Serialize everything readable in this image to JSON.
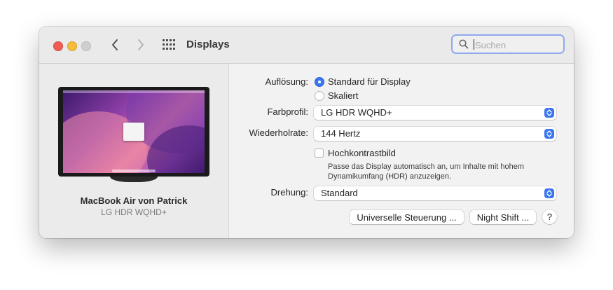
{
  "window": {
    "title": "Displays"
  },
  "search": {
    "placeholder": "Suchen",
    "value": ""
  },
  "display": {
    "name": "MacBook Air von Patrick",
    "model": "LG HDR WQHD+"
  },
  "settings": {
    "resolution": {
      "label": "Auflösung:",
      "options": [
        {
          "label": "Standard für Display",
          "selected": true
        },
        {
          "label": "Skaliert",
          "selected": false
        }
      ]
    },
    "color_profile": {
      "label": "Farbprofil:",
      "value": "LG HDR WQHD+"
    },
    "refresh_rate": {
      "label": "Wiederholrate:",
      "value": "144 Hertz"
    },
    "high_contrast": {
      "label": "Hochkontrastbild",
      "checked": false,
      "description_line1": "Passe das Display automatisch an, um Inhalte mit hohem",
      "description_line2": "Dynamikumfang (HDR) anzuzeigen."
    },
    "rotation": {
      "label": "Drehung:",
      "value": "Standard"
    }
  },
  "buttons": {
    "universal_control": "Universelle Steuerung ...",
    "night_shift": "Night Shift ...",
    "help": "?"
  },
  "colors": {
    "accent": "#3a76f0",
    "traffic_red": "#ee5e57",
    "traffic_yellow": "#f5bd3a"
  }
}
